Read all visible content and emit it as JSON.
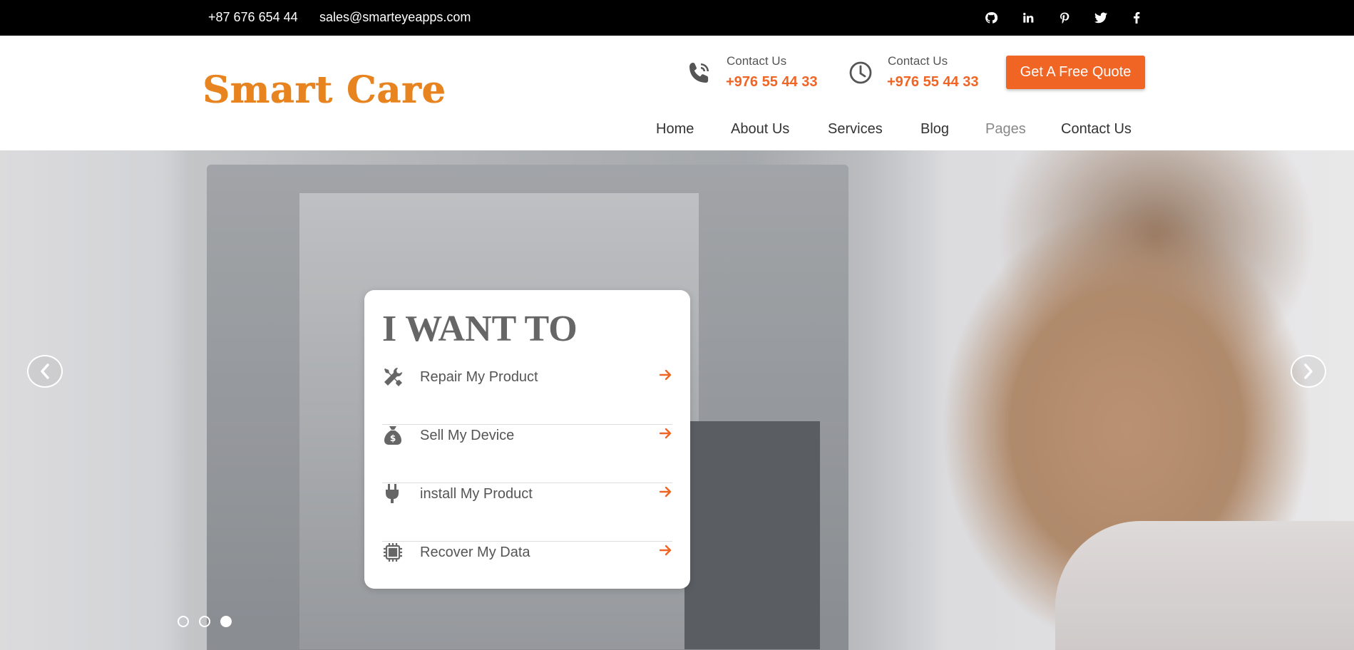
{
  "topbar": {
    "phone": "+87 676 654 44",
    "email": "sales@smarteyeapps.com",
    "social_icons": [
      "github-icon",
      "linkedin-icon",
      "pinterest-icon",
      "twitter-icon",
      "facebook-icon"
    ]
  },
  "header": {
    "logo": "Smart Care",
    "contacts": [
      {
        "icon": "phone-icon",
        "label": "Contact Us",
        "value": "+976 55 44 33"
      },
      {
        "icon": "clock-icon",
        "label": "Contact Us",
        "value": "+976 55 44 33"
      }
    ],
    "quote_button": "Get A Free Quote",
    "nav": [
      "Home",
      "About Us",
      "Services",
      "Blog",
      "Pages",
      "Contact Us"
    ]
  },
  "hero": {
    "card_title": "I WANT TO",
    "options": [
      {
        "icon": "tools-icon",
        "label": "Repair My Product"
      },
      {
        "icon": "money-bag-icon",
        "label": "Sell My Device"
      },
      {
        "icon": "plug-icon",
        "label": "install My Product"
      },
      {
        "icon": "chip-icon",
        "label": "Recover My Data"
      }
    ],
    "slides": 3,
    "active_slide": 3
  },
  "colors": {
    "accent": "#f06424",
    "logo": "#e8841f",
    "topbar": "#000000"
  }
}
